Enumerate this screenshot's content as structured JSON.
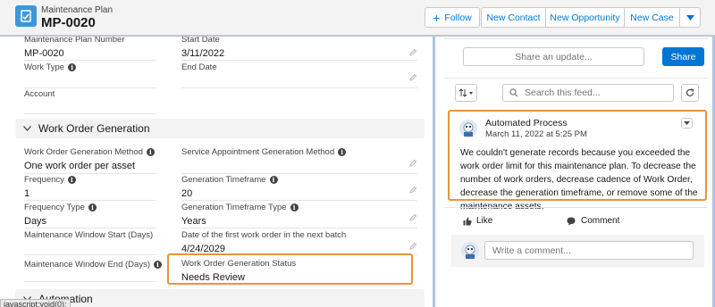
{
  "header": {
    "object_type": "Maintenance Plan",
    "record_name": "MP-0020",
    "buttons": {
      "follow": "Follow",
      "new_contact": "New Contact",
      "new_opportunity": "New Opportunity",
      "new_case": "New Case"
    }
  },
  "details": {
    "maintenance_plan_number": {
      "label": "Maintenance Plan Number",
      "value": "MP-0020"
    },
    "start_date": {
      "label": "Start Date",
      "value": "3/11/2022"
    },
    "work_type": {
      "label": "Work Type",
      "value": ""
    },
    "end_date": {
      "label": "End Date",
      "value": ""
    },
    "account": {
      "label": "Account",
      "value": ""
    }
  },
  "work_order_generation": {
    "section_title": "Work Order Generation",
    "generation_method": {
      "label": "Work Order Generation Method",
      "value": "One work order per asset"
    },
    "service_appointment_method": {
      "label": "Service Appointment Generation Method",
      "value": ""
    },
    "frequency": {
      "label": "Frequency",
      "value": "1"
    },
    "generation_timeframe": {
      "label": "Generation Timeframe",
      "value": "20"
    },
    "frequency_type": {
      "label": "Frequency Type",
      "value": "Days"
    },
    "generation_timeframe_type": {
      "label": "Generation Timeframe Type",
      "value": "Years"
    },
    "window_start": {
      "label": "Maintenance Window Start (Days)",
      "value": ""
    },
    "first_work_order_date": {
      "label": "Date of the first work order in the next batch",
      "value": "4/24/2029"
    },
    "window_end": {
      "label": "Maintenance Window End (Days)",
      "value": ""
    },
    "generation_status": {
      "label": "Work Order Generation Status",
      "value": "Needs Review"
    }
  },
  "automation": {
    "section_title": "Automation"
  },
  "status_bar": {
    "text": "javascript:void(0);"
  },
  "feed": {
    "share_placeholder": "Share an update...",
    "share_button": "Share",
    "search_placeholder": "Search this feed...",
    "post": {
      "author": "Automated Process",
      "date": "March 11, 2022 at 5:25 PM",
      "body": "We couldn't generate records because you exceeded the work order limit for this maintenance plan. To decrease the number of work orders, decrease cadence of Work Order, decrease the generation timeframe, or remove some of the maintenance assets."
    },
    "like_label": "Like",
    "comment_label": "Comment",
    "comment_placeholder": "Write a comment..."
  },
  "colors": {
    "accent": "#0176d3",
    "highlight": "#e8953a",
    "background": "#b0c4df"
  }
}
